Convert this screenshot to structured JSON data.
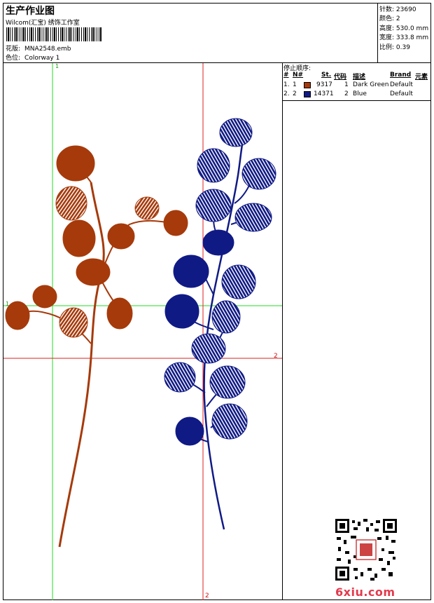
{
  "header": {
    "title": "生产作业图",
    "subtitle": "Wilcom(汇宝) 绣饰工作室",
    "design_label": "花版:",
    "design_value": "MNA2548.emb",
    "colorway_label": "色位:",
    "colorway_value": "Colorway 1"
  },
  "stats": [
    {
      "label": "针数:",
      "value": "23690"
    },
    {
      "label": "颜色:",
      "value": "2"
    },
    {
      "label": "高度:",
      "value": "530.0 mm"
    },
    {
      "label": "宽度:",
      "value": "333.8 mm"
    },
    {
      "label": "比例:",
      "value": "0.39"
    }
  ],
  "markers": {
    "v_green": "1",
    "h_green": "1",
    "h_red": "2",
    "v_red": "2"
  },
  "stop_sequence": {
    "title": "停止顺序:",
    "columns": [
      "#",
      "N#",
      "St.",
      "代码",
      "描述",
      "Brand",
      "元素"
    ],
    "rows": [
      {
        "num": "1.",
        "n": "1",
        "st": "9317",
        "code": "1",
        "desc": "Dark Green",
        "brand": "Default",
        "color": "#a63a0b"
      },
      {
        "num": "2.",
        "n": "2",
        "st": "14371",
        "code": "2",
        "desc": "Blue",
        "brand": "Default",
        "color": "#101a85"
      }
    ]
  },
  "colors": {
    "thread1": "#a63a0b",
    "thread2": "#101a85",
    "guide_green": "#22dd22",
    "guide_red": "#dd2222"
  },
  "watermark": {
    "site": "6xiu.com"
  }
}
